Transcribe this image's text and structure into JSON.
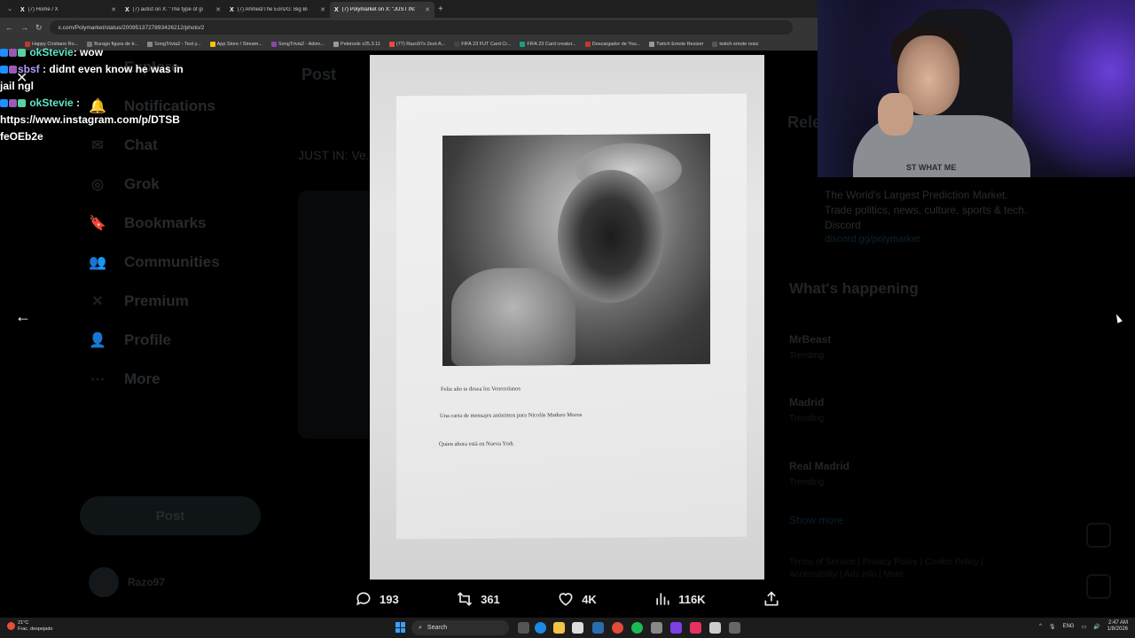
{
  "browser": {
    "tabs": [
      {
        "label": "(7) Home / X",
        "active": false
      },
      {
        "label": "(7) autist on X: \"The type of gi",
        "active": false
      },
      {
        "label": "(7) Ahmed/The Eors/G: Big Bi",
        "active": false
      },
      {
        "label": "(7) Polymarket on X: \"JUST IN:",
        "active": true
      }
    ],
    "url": "x.com/Polymarket/status/2009513727893426212/photo/2",
    "bookmarks": [
      {
        "label": "Happy Cristiano Ro...",
        "color": "#c0392b"
      },
      {
        "label": "Burago figura de tr...",
        "color": "#777777"
      },
      {
        "label": "SongTrivia2 - Test y...",
        "color": "#888888"
      },
      {
        "label": "App Store / Stream...",
        "color": "#f1c40f"
      },
      {
        "label": "SongTrivia2 - Advin...",
        "color": "#8e44ad"
      },
      {
        "label": "Peletools v25.3.11",
        "color": "#999999"
      },
      {
        "label": "(77) Razo97s Zest-A...",
        "color": "#e74c3c"
      },
      {
        "label": "FIFA 23 FUT Card Cr...",
        "color": "#444444"
      },
      {
        "label": "FIFA 23 Card creator...",
        "color": "#16a085"
      },
      {
        "label": "Descargador de You...",
        "color": "#c0392b"
      },
      {
        "label": "Twitch Emote Resizer",
        "color": "#999999"
      },
      {
        "label": "twitch emote resiz",
        "color": "#555555"
      }
    ]
  },
  "chat": [
    {
      "user": "okStevie",
      "message": ": wow"
    },
    {
      "user": "sbsf",
      "message": ": didnt even know he was in jail ngl"
    },
    {
      "user": "okStevie",
      "message": ":"
    },
    {
      "user": "",
      "message": "https://www.instagram.com/p/DTSB feOEb2e"
    }
  ],
  "background": {
    "nav": [
      "Explore",
      "Notifications",
      "Chat",
      "Grok",
      "Bookmarks",
      "Communities",
      "Premium",
      "Profile",
      "More"
    ],
    "post_button": "Post",
    "account_name": "Razo97",
    "column_header": "Post",
    "tweet_text": "JUST IN: Ve... mail, trolli...",
    "relevant_header": "Rele",
    "bio": "The World's Largest Prediction Market. Trade politics, news, culture, sports & tech. Discord",
    "bio_link": "discord.gg/polymarket",
    "happening_header": "What's happening",
    "trends": [
      {
        "name": "MrBeast",
        "sub": "Trending"
      },
      {
        "name": "Madrid",
        "sub": "Trending"
      },
      {
        "name": "Real Madrid",
        "sub": "Trending"
      }
    ],
    "show_more": "Show more",
    "footer": "Terms of Service | Privacy Policy | Cookie Policy | Accessibility | Ads info | More"
  },
  "photo": {
    "lines": [
      "Feliz año te desea los Venezolanos",
      "Una carta de mensajes anónimos para Nicolás Maduro Moros",
      "Quien ahora está en Nueva York"
    ]
  },
  "actions": {
    "replies": "193",
    "reposts": "361",
    "likes": "4K",
    "views": "116K"
  },
  "webcam": {
    "shirt_text": "ST WHAT ME"
  },
  "taskbar": {
    "temperature": "21°C",
    "weather": "Frac. despejado",
    "search": "Search",
    "language": "ENG",
    "time": "2:47 AM",
    "date": "1/8/2026"
  }
}
